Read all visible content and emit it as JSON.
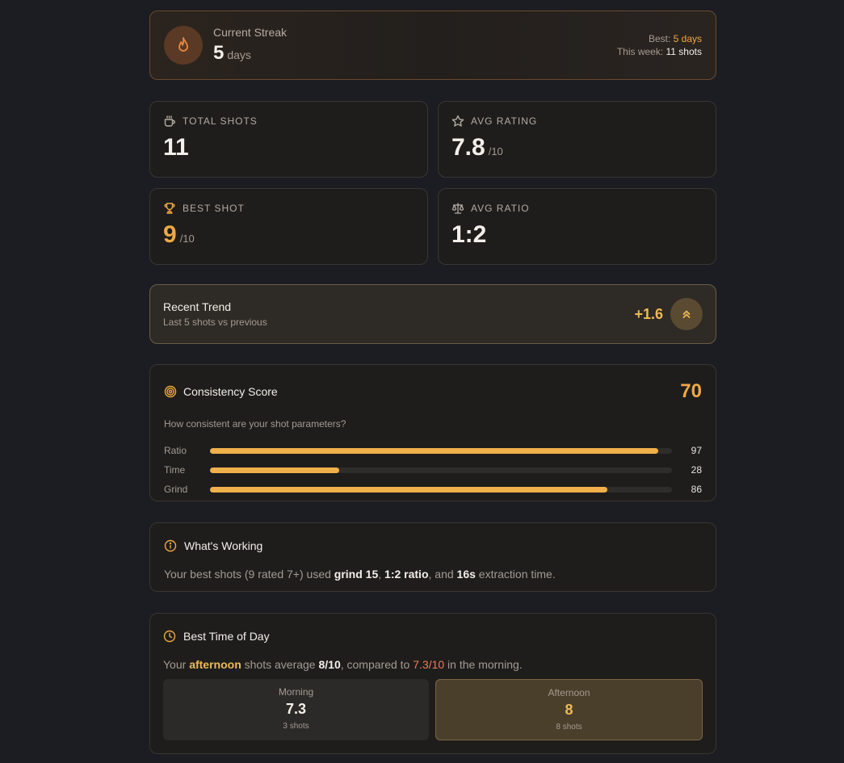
{
  "streak": {
    "label": "Current Streak",
    "value": "5",
    "unit": "days",
    "best_label": "Best:",
    "best_value": "5 days",
    "week_label": "This week:",
    "week_value": "11 shots"
  },
  "stats": {
    "total_shots": {
      "label": "TOTAL SHOTS",
      "value": "11",
      "icon": "coffee-cup-icon"
    },
    "avg_rating": {
      "label": "AVG RATING",
      "value": "7.8",
      "unit": "/10",
      "icon": "star-icon"
    },
    "best_shot": {
      "label": "BEST SHOT",
      "value": "9",
      "unit": "/10",
      "icon": "trophy-icon"
    },
    "avg_ratio": {
      "label": "AVG RATIO",
      "value": "1:2",
      "icon": "scale-icon"
    }
  },
  "trend": {
    "title": "Recent Trend",
    "subtitle": "Last 5 shots vs previous",
    "value": "+1.6",
    "icon": "double-chevron-up-icon"
  },
  "consistency": {
    "title": "Consistency Score",
    "score": "70",
    "question": "How consistent are your shot parameters?",
    "bars": [
      {
        "label": "Ratio",
        "value": 97,
        "display": "97"
      },
      {
        "label": "Time",
        "value": 28,
        "display": "28"
      },
      {
        "label": "Grind",
        "value": 86,
        "display": "86"
      }
    ]
  },
  "working": {
    "title": "What's Working",
    "text_1": "Your best shots (9 rated 7+) used ",
    "grind": "grind 15",
    "text_2": ", ",
    "ratio": "1:2 ratio",
    "text_3": ", and ",
    "time": "16s",
    "text_4": " extraction time."
  },
  "best_time": {
    "title": "Best Time of Day",
    "text_1": "Your ",
    "period": "afternoon",
    "text_2": " shots average ",
    "avg": "8/10",
    "text_3": ", compared to ",
    "compare": "7.3/10",
    "text_4": " in the morning.",
    "morning": {
      "label": "Morning",
      "value": "7.3",
      "sub": "3 shots"
    },
    "afternoon": {
      "label": "Afternoon",
      "value": "8",
      "sub": "8 shots"
    }
  },
  "colors": {
    "accent": "#f0a843",
    "background": "#1b1d22",
    "card": "#1e1d1c",
    "highlight_red": "#f07a55"
  }
}
